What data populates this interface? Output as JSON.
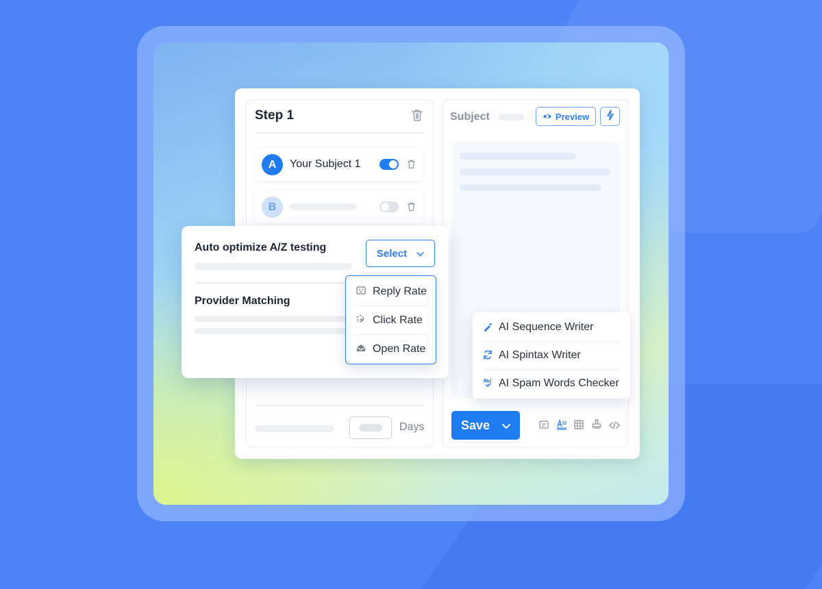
{
  "step": {
    "title": "Step 1",
    "variants": [
      {
        "letter": "A",
        "subject": "Your Subject 1",
        "enabled": true
      },
      {
        "letter": "B",
        "subject": "",
        "enabled": false
      }
    ],
    "days_label": "Days"
  },
  "editor": {
    "subject_label": "Subject",
    "preview_label": "Preview",
    "save_label": "Save"
  },
  "popup": {
    "auto_optimize_label": "Auto optimize A/Z testing",
    "select_label": "Select",
    "provider_matching_label": "Provider Matching",
    "options": [
      "Reply Rate",
      "Click Rate",
      "Open Rate"
    ]
  },
  "ai_menu": {
    "items": [
      "AI Sequence Writer",
      "AI Spintax Writer",
      "AI Spam Words Checker"
    ]
  },
  "toolbar_icons": [
    "template-icon",
    "text-format-icon",
    "table-icon",
    "stamp-icon",
    "code-icon"
  ],
  "colors": {
    "accent": "#1f7cf1",
    "background": "#4d83f7"
  }
}
